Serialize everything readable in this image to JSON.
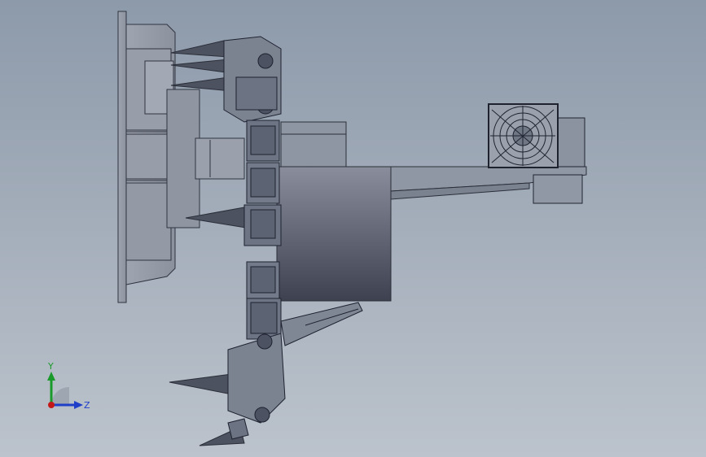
{
  "viewport": {
    "background_top": "#8d9aaa",
    "background_bottom": "#bcc3cc"
  },
  "triad": {
    "y_label": "Y",
    "z_label": "Z",
    "y_color": "#1a9a2a",
    "z_color": "#1f3fc8",
    "x_color": "#c21818"
  }
}
